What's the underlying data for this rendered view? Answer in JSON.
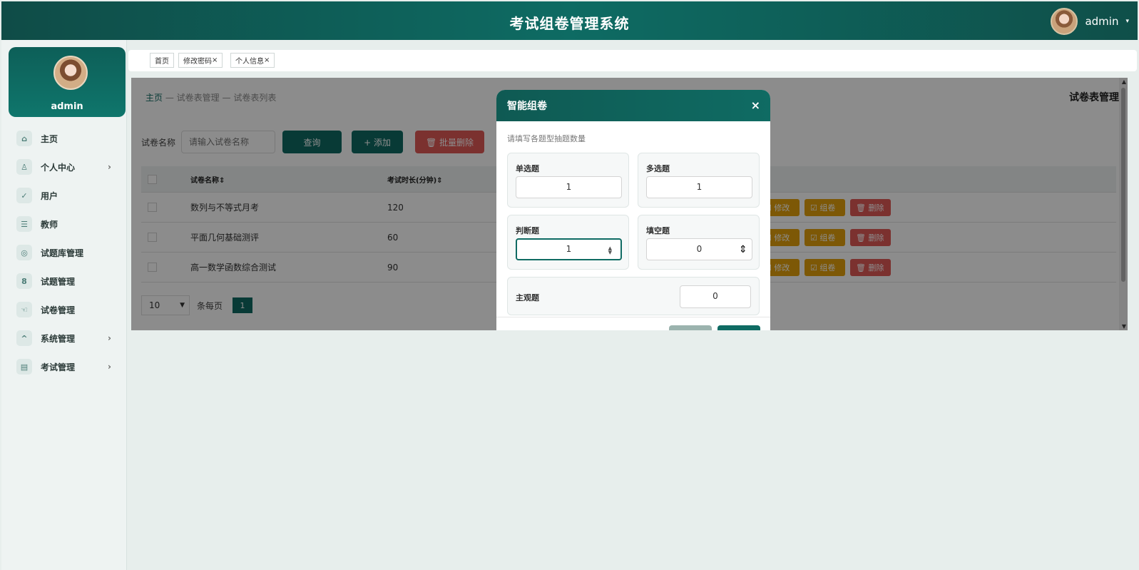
{
  "app": {
    "title": "考试组卷管理系统",
    "username": "admin",
    "caret": "▾"
  },
  "sidebar": {
    "profile_name": "admin",
    "items": [
      {
        "label": "主页",
        "icon": "⌂",
        "arrow": ""
      },
      {
        "label": "个人中心",
        "icon": "♙",
        "arrow": "›"
      },
      {
        "label": "用户",
        "icon": "✓",
        "arrow": ""
      },
      {
        "label": "教师",
        "icon": "☰",
        "arrow": ""
      },
      {
        "label": "试题库管理",
        "icon": "◎",
        "arrow": ""
      },
      {
        "label": "试题管理",
        "icon": "8",
        "arrow": ""
      },
      {
        "label": "试卷管理",
        "icon": "☜",
        "arrow": ""
      },
      {
        "label": "系统管理",
        "icon": "^",
        "arrow": "›"
      },
      {
        "label": "考试管理",
        "icon": "▤",
        "arrow": "›"
      }
    ]
  },
  "tabs": [
    {
      "label": "首页",
      "close": ""
    },
    {
      "label": "修改密码",
      "close": "×"
    },
    {
      "label": "个人信息",
      "close": "×"
    }
  ],
  "breadcrumb": {
    "home": "主页",
    "sep1": " — ",
    "level1": "试卷表管理",
    "sep2": " — ",
    "level2": "试卷表列表"
  },
  "panel_title": "试卷表管理",
  "search": {
    "label": "试卷名称",
    "placeholder": "请输入试卷名称",
    "query_label": "查询",
    "add_label": "+ 添加",
    "batch_delete_label": "🗑 批量删除"
  },
  "table": {
    "headers": {
      "name": "试卷名称⇕",
      "duration": "考试时长(分钟)⇕"
    },
    "rows": [
      {
        "name": "数列与不等式月考",
        "duration": "120"
      },
      {
        "name": "平面几何基础测评",
        "duration": "60"
      },
      {
        "name": "高一数学函数综合测试",
        "duration": "90"
      }
    ],
    "actions": {
      "edit": "☑ 修改",
      "compose": "☑ 组卷",
      "delete": "🗑 删除"
    }
  },
  "pager": {
    "page_size": "10",
    "per_page_label": "条每页",
    "current_page": "1"
  },
  "dialog": {
    "title": "智能组卷",
    "close": "×",
    "hint": "请填写各题型抽题数量",
    "fields": {
      "single": {
        "label": "单选题",
        "value": "1"
      },
      "multi": {
        "label": "多选题",
        "value": "1"
      },
      "judge": {
        "label": "判断题",
        "value": "1"
      },
      "fill": {
        "label": "填空题",
        "value": "0"
      },
      "subjective": {
        "label": "主观题",
        "value": "0"
      }
    }
  },
  "colors": {
    "primary": "#0f6b63",
    "header": "#0e6b63",
    "danger": "#e05a57",
    "warning": "#e3a10b"
  }
}
